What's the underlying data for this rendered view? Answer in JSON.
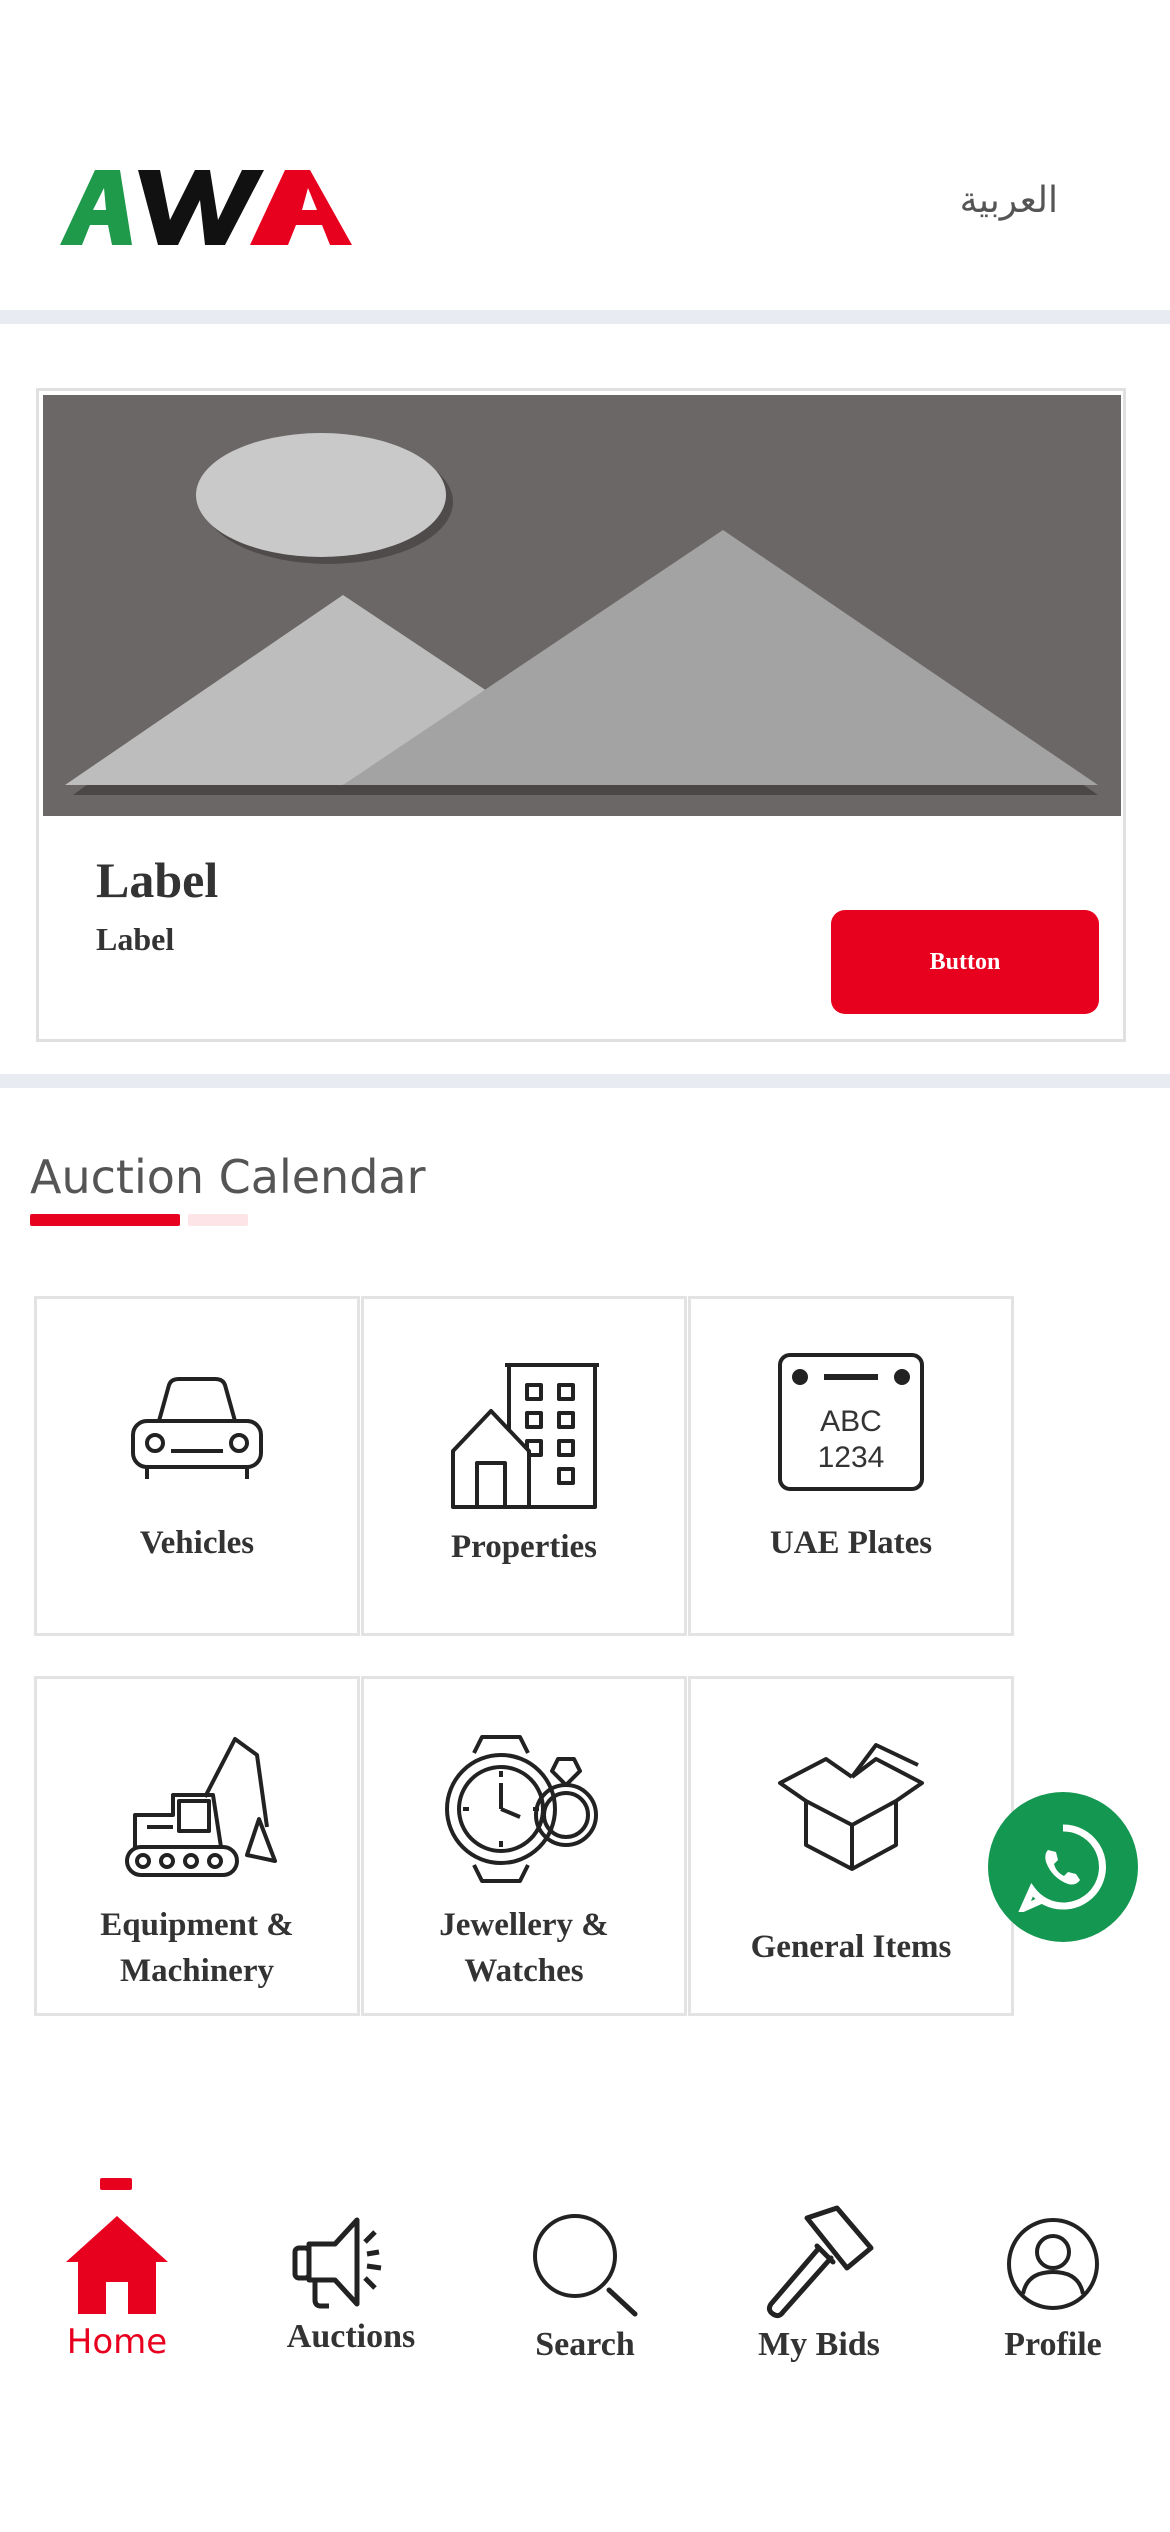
{
  "header": {
    "logo_text": "AWA",
    "language_link": "العربية"
  },
  "banner": {
    "title": "Label",
    "subtitle": "Label",
    "button_label": "Button"
  },
  "calendar": {
    "title": "Auction Calendar",
    "categories": [
      {
        "label": "Vehicles",
        "icon": "car-icon"
      },
      {
        "label": "Properties",
        "icon": "buildings-icon"
      },
      {
        "label": "UAE Plates",
        "icon": "plate-icon",
        "plate_top": "ABC",
        "plate_bottom": "1234"
      },
      {
        "label_line1": "Equipment &",
        "label_line2": "Machinery",
        "icon": "excavator-icon"
      },
      {
        "label_line1": "Jewellery &",
        "label_line2": "Watches",
        "icon": "watch-ring-icon"
      },
      {
        "label": "General Items",
        "icon": "box-icon"
      }
    ]
  },
  "bottom_nav": {
    "items": [
      {
        "label": "Home",
        "icon": "home-icon",
        "active": true
      },
      {
        "label": "Auctions",
        "icon": "megaphone-icon",
        "active": false
      },
      {
        "label": "Search",
        "icon": "search-icon",
        "active": false
      },
      {
        "label": "My Bids",
        "icon": "gavel-icon",
        "active": false
      },
      {
        "label": "Profile",
        "icon": "profile-icon",
        "active": false
      }
    ]
  },
  "colors": {
    "brand_red": "#e8001f",
    "brand_green": "#1f9a4a",
    "whatsapp_green": "#139751",
    "divider": "#e8ecf2"
  }
}
